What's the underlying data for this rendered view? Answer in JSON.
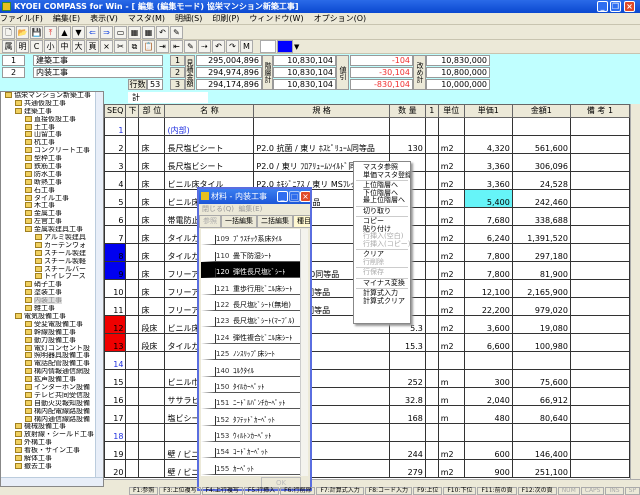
{
  "window": {
    "title": "KYOEI COMPASS for Win - [ 編集 (編集モード) 協栄マンション新築工事]",
    "controls": [
      "minimize",
      "restore",
      "close"
    ]
  },
  "menu": [
    "ファイル(F)",
    "編集(E)",
    "表示(V)",
    "マスタ(M)",
    "明細(S)",
    "印刷(P)",
    "ウィンドウ(W)",
    "オプション(O)"
  ],
  "toolbar1": [
    "new-icon",
    "open-icon",
    "save-icon",
    "top-arrow-icon",
    "up-arrow-icon",
    "down-arrow-icon",
    "left-arrow-icon",
    "right-arrow-icon",
    "window-icon",
    "grid-icon",
    "grid2-icon",
    "undo-red-icon",
    "pen-icon"
  ],
  "toolbar2": [
    "属",
    "明",
    "C",
    "小",
    "中",
    "大",
    "頁",
    "×",
    "✂",
    "⧉",
    "📋",
    "⇥",
    "⇤",
    "✎",
    "⇢",
    "↶",
    "↷",
    "M"
  ],
  "accent_colors": {
    "selected_color": "#0000ff"
  },
  "summary": {
    "levels": [
      {
        "no": "1",
        "name": "建築工事"
      },
      {
        "no": "2",
        "name": "内装工事"
      }
    ],
    "row_count_label": "行数",
    "row_count": "53",
    "estimate_label": "見積金額",
    "hierarchy_label": "階層計",
    "discount_label": "値引",
    "revised_label": "改め計",
    "rows": [
      {
        "no": "1",
        "estimate": "295,004,896",
        "hierarchy": "10,830,104",
        "discount": "-104",
        "revised": "10,830,000"
      },
      {
        "no": "2",
        "estimate": "294,974,896",
        "hierarchy": "10,830,104",
        "discount": "-30,104",
        "revised": "10,800,000"
      },
      {
        "no": "3",
        "estimate": "294,174,896",
        "hierarchy": "10,830,104",
        "discount": "-830,104",
        "revised": "10,000,000"
      }
    ]
  },
  "total_label": "計",
  "tree": [
    {
      "l": 0,
      "t": "協栄マンション新築工事"
    },
    {
      "l": 1,
      "t": "共通仮設工事"
    },
    {
      "l": 1,
      "t": "建築工事"
    },
    {
      "l": 2,
      "t": "直接仮設工事"
    },
    {
      "l": 2,
      "t": "土工事"
    },
    {
      "l": 2,
      "t": "山留工事"
    },
    {
      "l": 2,
      "t": "杭工事"
    },
    {
      "l": 2,
      "t": "コンクリート工事"
    },
    {
      "l": 2,
      "t": "型枠工事"
    },
    {
      "l": 2,
      "t": "鉄筋工事"
    },
    {
      "l": 2,
      "t": "防水工事"
    },
    {
      "l": 2,
      "t": "断熱工事"
    },
    {
      "l": 2,
      "t": "石工事"
    },
    {
      "l": 2,
      "t": "タイル工事"
    },
    {
      "l": 2,
      "t": "木工事"
    },
    {
      "l": 2,
      "t": "金属工事"
    },
    {
      "l": 2,
      "t": "左官工事"
    },
    {
      "l": 2,
      "t": "金属製建具工事"
    },
    {
      "l": 3,
      "t": "アルミ製建具"
    },
    {
      "l": 3,
      "t": "カーテンウォ"
    },
    {
      "l": 3,
      "t": "スチール製建"
    },
    {
      "l": 3,
      "t": "スチール製軽"
    },
    {
      "l": 3,
      "t": "スチールバー"
    },
    {
      "l": 3,
      "t": "トイレブース"
    },
    {
      "l": 2,
      "t": "硝子工事"
    },
    {
      "l": 2,
      "t": "塗装工事"
    },
    {
      "l": 2,
      "t": "内装工事",
      "sel": true
    },
    {
      "l": 2,
      "t": "雑工事"
    },
    {
      "l": 1,
      "t": "電気設備工事"
    },
    {
      "l": 2,
      "t": "受変電設備工事"
    },
    {
      "l": 2,
      "t": "幹線設備工事"
    },
    {
      "l": 2,
      "t": "動力設備工事"
    },
    {
      "l": 2,
      "t": "電灯コンセント設"
    },
    {
      "l": 2,
      "t": "照明器具設備工事"
    },
    {
      "l": 2,
      "t": "電話配管設備工事"
    },
    {
      "l": 2,
      "t": "構内情報通信網設"
    },
    {
      "l": 2,
      "t": "拡声設備工事"
    },
    {
      "l": 2,
      "t": "インターホン設備"
    },
    {
      "l": 2,
      "t": "テレビ共同受信設"
    },
    {
      "l": 2,
      "t": "自動火災報知設備"
    },
    {
      "l": 2,
      "t": "構内配電線路設備"
    },
    {
      "l": 2,
      "t": "構内通信線路設備"
    },
    {
      "l": 1,
      "t": "機械設備工事"
    },
    {
      "l": 1,
      "t": "放射線・シールド工事"
    },
    {
      "l": 1,
      "t": "外構工事"
    },
    {
      "l": 1,
      "t": "看板・サイン工事"
    },
    {
      "l": 1,
      "t": "解体工事"
    },
    {
      "l": 1,
      "t": "撤去工事"
    }
  ],
  "table": {
    "headers": [
      "SEQ",
      "下",
      "部 位",
      "名 称",
      "規 格",
      "数 量",
      "1",
      "単位",
      "単価1",
      "金額1",
      "備 考 1"
    ],
    "rows": [
      {
        "seq": "1",
        "seqc": "blue",
        "part": "",
        "name": "(内部)",
        "namec": "blue",
        "spec": "",
        "qty": "",
        "unit": "",
        "price": "",
        "amount": ""
      },
      {
        "seq": "2",
        "part": "床",
        "name": "長尺塩ビシート",
        "spec": "P2.0 抗菌 / 東リ ﾎｽﾋﾟﾘｭｰﾑ同等品",
        "qty": "130",
        "unit": "m2",
        "price": "4,320",
        "amount": "561,600"
      },
      {
        "seq": "3",
        "part": "床",
        "name": "長尺塩ビシート",
        "spec": "P2.0 / 東リ ﾌﾛｱﾘｭｰﾑｿｲﾙﾄﾞ同等品",
        "qty": "",
        "unit": "m2",
        "price": "3,360",
        "amount": "306,096"
      },
      {
        "seq": "4",
        "part": "床",
        "name": "ビニル床タイル",
        "spec": "P2.0 ﾎﾓｼﾞﾆｱｽ / 東リ MSﾌﾚｯｼｭ同等品",
        "qty": "",
        "unit": "m2",
        "price": "3,360",
        "amount": "24,528"
      },
      {
        "seq": "5",
        "part": "床",
        "name": "ビニル床タイル",
        "spec": "73.0 ﾎﾓｼﾞﾆ / 等品",
        "qty": "",
        "unit": "m2",
        "price": "5,400",
        "pricebg": "cyan",
        "amount": "242,460"
      },
      {
        "seq": "6",
        "part": "床",
        "name": "帯電防止",
        "spec": "Lﾌﾘｰ500同等",
        "qty": "",
        "unit": "m2",
        "price": "7,680",
        "amount": "338,688"
      },
      {
        "seq": "7",
        "part": "床",
        "name": "タイルカ",
        "spec": "",
        "qty": "",
        "unit": "m2",
        "price": "6,240",
        "amount": "1,391,520"
      },
      {
        "seq": "8",
        "seqbg": "blue",
        "part": "床",
        "name": "タイルカ",
        "spec": "品",
        "qty": "",
        "unit": "m2",
        "price": "7,800",
        "amount": "297,180"
      },
      {
        "seq": "9",
        "seqbg": "blue",
        "part": "床",
        "name": "フリーア",
        "spec": "0 3000N / ｴ-40同等品",
        "qty": "",
        "unit": "m2",
        "price": "7,800",
        "amount": "81,900"
      },
      {
        "seq": "10",
        "part": "床",
        "name": "フリーア",
        "spec": "0 3000N / ｽﾞ同等品",
        "qty": "",
        "unit": "m2",
        "price": "12,100",
        "amount": "2,165,900"
      },
      {
        "seq": "11",
        "part": "床",
        "name": "フリーア",
        "spec": "0 5000N / ｽﾞ同等品",
        "qty": "",
        "unit": "m2",
        "price": "22,200",
        "amount": "979,020"
      },
      {
        "seq": "12",
        "seqbg": "red",
        "part": "段床",
        "name": "ビニル床",
        "spec": "同等品",
        "qty": "5.3",
        "unit": "m2",
        "price": "3,600",
        "amount": "19,080"
      },
      {
        "seq": "13",
        "seqbg": "red",
        "part": "段床",
        "name": "タイルカ",
        "spec": "",
        "qty": "15.3",
        "unit": "m2",
        "price": "6,600",
        "amount": "100,980"
      },
      {
        "seq": "14",
        "seqc": "blue",
        "part": "",
        "name": "",
        "spec": "",
        "qty": "",
        "unit": "",
        "price": "",
        "amount": ""
      },
      {
        "seq": "15",
        "part": "",
        "name": "ビニル巾",
        "spec": "",
        "qty": "252",
        "unit": "m",
        "price": "300",
        "amount": "75,600"
      },
      {
        "seq": "16",
        "part": "",
        "name": "ササラビ",
        "spec": "",
        "qty": "32.8",
        "unit": "m",
        "price": "2,040",
        "amount": "66,912"
      },
      {
        "seq": "17",
        "part": "",
        "name": "塩ビシー",
        "spec": "下地共",
        "qty": "168",
        "unit": "m",
        "price": "480",
        "amount": "80,640"
      },
      {
        "seq": "18",
        "seqc": "blue",
        "part": "",
        "name": "",
        "spec": "",
        "qty": "",
        "unit": "",
        "price": "",
        "amount": ""
      },
      {
        "seq": "19",
        "part": "",
        "name": "壁 / ビニール",
        "spec": "",
        "qty": "244",
        "unit": "m2",
        "price": "600",
        "amount": "146,400"
      },
      {
        "seq": "20",
        "part": "",
        "name": "壁 / ビニール",
        "spec": "台",
        "qty": "279",
        "unit": "m2",
        "price": "900",
        "amount": "251,100"
      }
    ]
  },
  "popup": {
    "title": "材料 - 内装工事",
    "menu": [
      "閉じる(Q)",
      "編集(E)"
    ],
    "tabs": [
      "参照",
      "一括編集",
      "二括編集",
      "種目",
      "科目"
    ],
    "items": [
      {
        "code": "109",
        "name": "ﾌﾟﾗｽﾁｯｸ系床ﾀｲﾙ"
      },
      {
        "code": "110",
        "name": "畳下防湿ｼｰﾄ"
      },
      {
        "code": "120",
        "name": "弾性長尺塩ﾋﾞｼｰﾄ",
        "sel": true
      },
      {
        "code": "121",
        "name": "重歩行用ﾋﾞﾆﾙ床ｼｰﾄ"
      },
      {
        "code": "122",
        "name": "長尺塩ﾋﾞｼｰﾄ(無地)"
      },
      {
        "code": "123",
        "name": "長尺塩ﾋﾞｼｰﾄ(ﾏｰﾌﾞﾙ)"
      },
      {
        "code": "124",
        "name": "弾性複合ﾋﾞﾆﾙ床ｼｰﾄ"
      },
      {
        "code": "125",
        "name": "ﾉﾝｽﾘｯﾌﾟ床ｼｰﾄ"
      },
      {
        "code": "140",
        "name": "ｺﾙｸﾀｲﾙ"
      },
      {
        "code": "150",
        "name": "ﾀｲﾙｶｰﾍﾟｯﾄ"
      },
      {
        "code": "151",
        "name": "ﾆｰﾄﾞﾙﾊﾟﾝﾁｶｰﾍﾟｯﾄ"
      },
      {
        "code": "152",
        "name": "ﾀﾌﾃｯﾄﾞｶｰﾍﾟｯﾄ"
      },
      {
        "code": "153",
        "name": "ｳｨﾙﾄﾝｶｰﾍﾟｯﾄ"
      },
      {
        "code": "154",
        "name": "ｺｰﾄﾞｶｰﾍﾟｯﾄ"
      },
      {
        "code": "155",
        "name": "ｶｰﾍﾟｯﾄ"
      }
    ],
    "ok": "OK"
  },
  "context_menu": [
    {
      "t": "マスタ参照"
    },
    {
      "t": "単価マスタ登録"
    },
    {
      "sep": true
    },
    {
      "t": "上位階層へ"
    },
    {
      "t": "下位階層へ"
    },
    {
      "t": "最上位階層へ"
    },
    {
      "sep": true
    },
    {
      "t": "切り取り"
    },
    {
      "sep": true
    },
    {
      "t": "コピー"
    },
    {
      "t": "貼り付け"
    },
    {
      "t": "行挿入(空白)",
      "dis": true
    },
    {
      "t": "行挿入(コピー)",
      "dis": true
    },
    {
      "sep": true
    },
    {
      "t": "クリア"
    },
    {
      "t": "行削除",
      "dis": true
    },
    {
      "sep": true
    },
    {
      "t": "行保存",
      "dis": true
    },
    {
      "sep": true
    },
    {
      "t": "マイナス変換"
    },
    {
      "sep": true
    },
    {
      "t": "計算式入力"
    },
    {
      "t": "計算式クリア"
    }
  ],
  "status": [
    {
      "t": "F1:参照"
    },
    {
      "t": "F3:上位複写"
    },
    {
      "t": "F4:上行複写"
    },
    {
      "t": "F5:行挿入"
    },
    {
      "t": "F6:行削除"
    },
    {
      "t": "F7:計算式入力"
    },
    {
      "t": "F8:コード入力"
    },
    {
      "t": "F9:上位"
    },
    {
      "t": "F10:下位"
    },
    {
      "t": "F11:前の頁"
    },
    {
      "t": "F12:次の頁"
    },
    {
      "t": "NUM",
      "dim": true
    },
    {
      "t": "CAPS",
      "dim": true
    },
    {
      "t": "INS",
      "dim": true
    },
    {
      "t": "SP",
      "dim": true
    }
  ]
}
